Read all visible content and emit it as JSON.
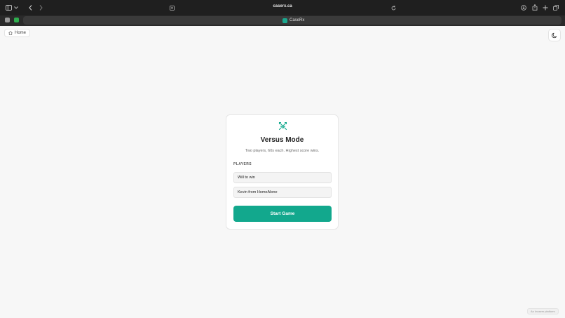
{
  "browser": {
    "url": "caserx.ca",
    "tab_title": "CaseRx"
  },
  "header": {
    "home_label": "Home"
  },
  "card": {
    "title": "Versus Mode",
    "subtitle": "Two players, 60s each. Highest score wins.",
    "players_label": "PLAYERS",
    "player1_value": "Will to win",
    "player2_value": "Kevin from HomeAlone",
    "start_label": "Start Game"
  },
  "footer": {
    "tag": "An Inusem platform"
  },
  "colors": {
    "accent": "#12a88d",
    "background": "#f7f7f7"
  },
  "icons": {
    "card": "crossed-swords-icon",
    "theme": "moon-icon",
    "home": "house-icon"
  }
}
